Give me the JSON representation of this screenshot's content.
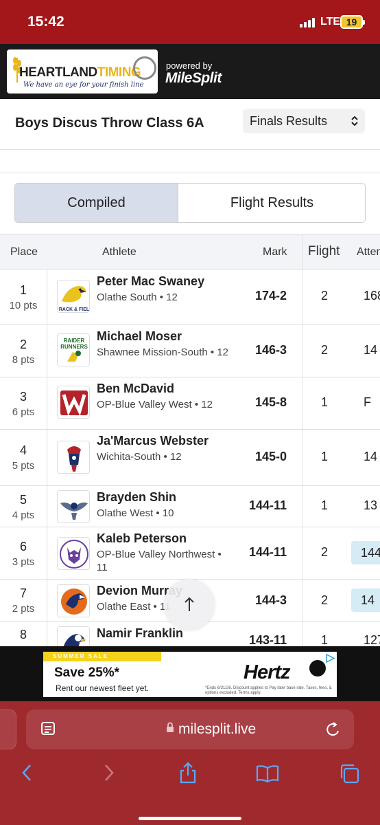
{
  "status_bar": {
    "time": "15:42",
    "network": "LTE",
    "battery": "19"
  },
  "header": {
    "logo_left": "HEARTLAND",
    "logo_right": "TIMING",
    "logo_tagline": "We have an eye for your finish line",
    "powered_by": "powered by",
    "milesplit": "MileSplit"
  },
  "page": {
    "title": "Boys Discus Throw Class 6A",
    "results_select": "Finals Results"
  },
  "tabs": {
    "compiled": "Compiled",
    "flight": "Flight Results"
  },
  "table": {
    "headers": {
      "place": "Place",
      "athlete": "Athlete",
      "mark": "Mark",
      "flight": "Flight",
      "attempts": "Atten"
    },
    "rows": [
      {
        "place": "1",
        "pts": "10 pts",
        "name": "Peter Mac Swaney",
        "team": "Olathe South • 12",
        "mark": "174-2",
        "flight": "2",
        "attempt": "168",
        "highlight": false,
        "logo": "olathe-south-logo"
      },
      {
        "place": "2",
        "pts": "8 pts",
        "name": "Michael Moser",
        "team": "Shawnee Mission-South • 12",
        "mark": "146-3",
        "flight": "2",
        "attempt": "14",
        "highlight": false,
        "logo": "raider-runners-logo"
      },
      {
        "place": "3",
        "pts": "6 pts",
        "name": "Ben McDavid",
        "team": "OP-Blue Valley West • 12",
        "mark": "145-8",
        "flight": "1",
        "attempt": "F",
        "highlight": false,
        "logo": "blue-valley-west-logo"
      },
      {
        "place": "4",
        "pts": "5 pts",
        "name": "Ja'Marcus Webster",
        "team": "Wichita-South • 12",
        "mark": "145-0",
        "flight": "1",
        "attempt": "14",
        "highlight": false,
        "logo": "wichita-south-logo"
      },
      {
        "place": "5",
        "pts": "4 pts",
        "name": "Brayden Shin",
        "team": "Olathe West • 10",
        "mark": "144-11",
        "flight": "1",
        "attempt": "13",
        "highlight": false,
        "logo": "olathe-west-logo"
      },
      {
        "place": "6",
        "pts": "3 pts",
        "name": "Kaleb Peterson",
        "team": "OP-Blue Valley Northwest • 11",
        "mark": "144-11",
        "flight": "2",
        "attempt": "144",
        "highlight": true,
        "logo": "blue-valley-northwest-logo"
      },
      {
        "place": "7",
        "pts": "2 pts",
        "name": "Devion Murray",
        "team": "Olathe East • 11",
        "mark": "144-3",
        "flight": "2",
        "attempt": "14",
        "highlight": true,
        "logo": "olathe-east-logo"
      },
      {
        "place": "8",
        "pts": "",
        "name": "Namir Franklin",
        "team": "",
        "mark": "143-11",
        "flight": "1",
        "attempt": "127",
        "highlight": false,
        "logo": "eagle-logo"
      }
    ]
  },
  "ad": {
    "strip": "SUMMER SALE",
    "headline": "Save 25%*",
    "sub": "Rent our newest fleet yet.",
    "brand": "Hertz",
    "fine": "*Ends 6/31/26. Discount applies to Pay later base rate. Taxes, fees, & options excluded. Terms apply."
  },
  "browser": {
    "url": "milesplit.live"
  },
  "colors": {
    "status_bar": "#a3161a",
    "header": "#1a1a1a",
    "tab_active": "#d8ddec",
    "highlight": "#d5ecf7",
    "browser": "#9e2a2e",
    "logo_accent": "#e8b51a"
  }
}
